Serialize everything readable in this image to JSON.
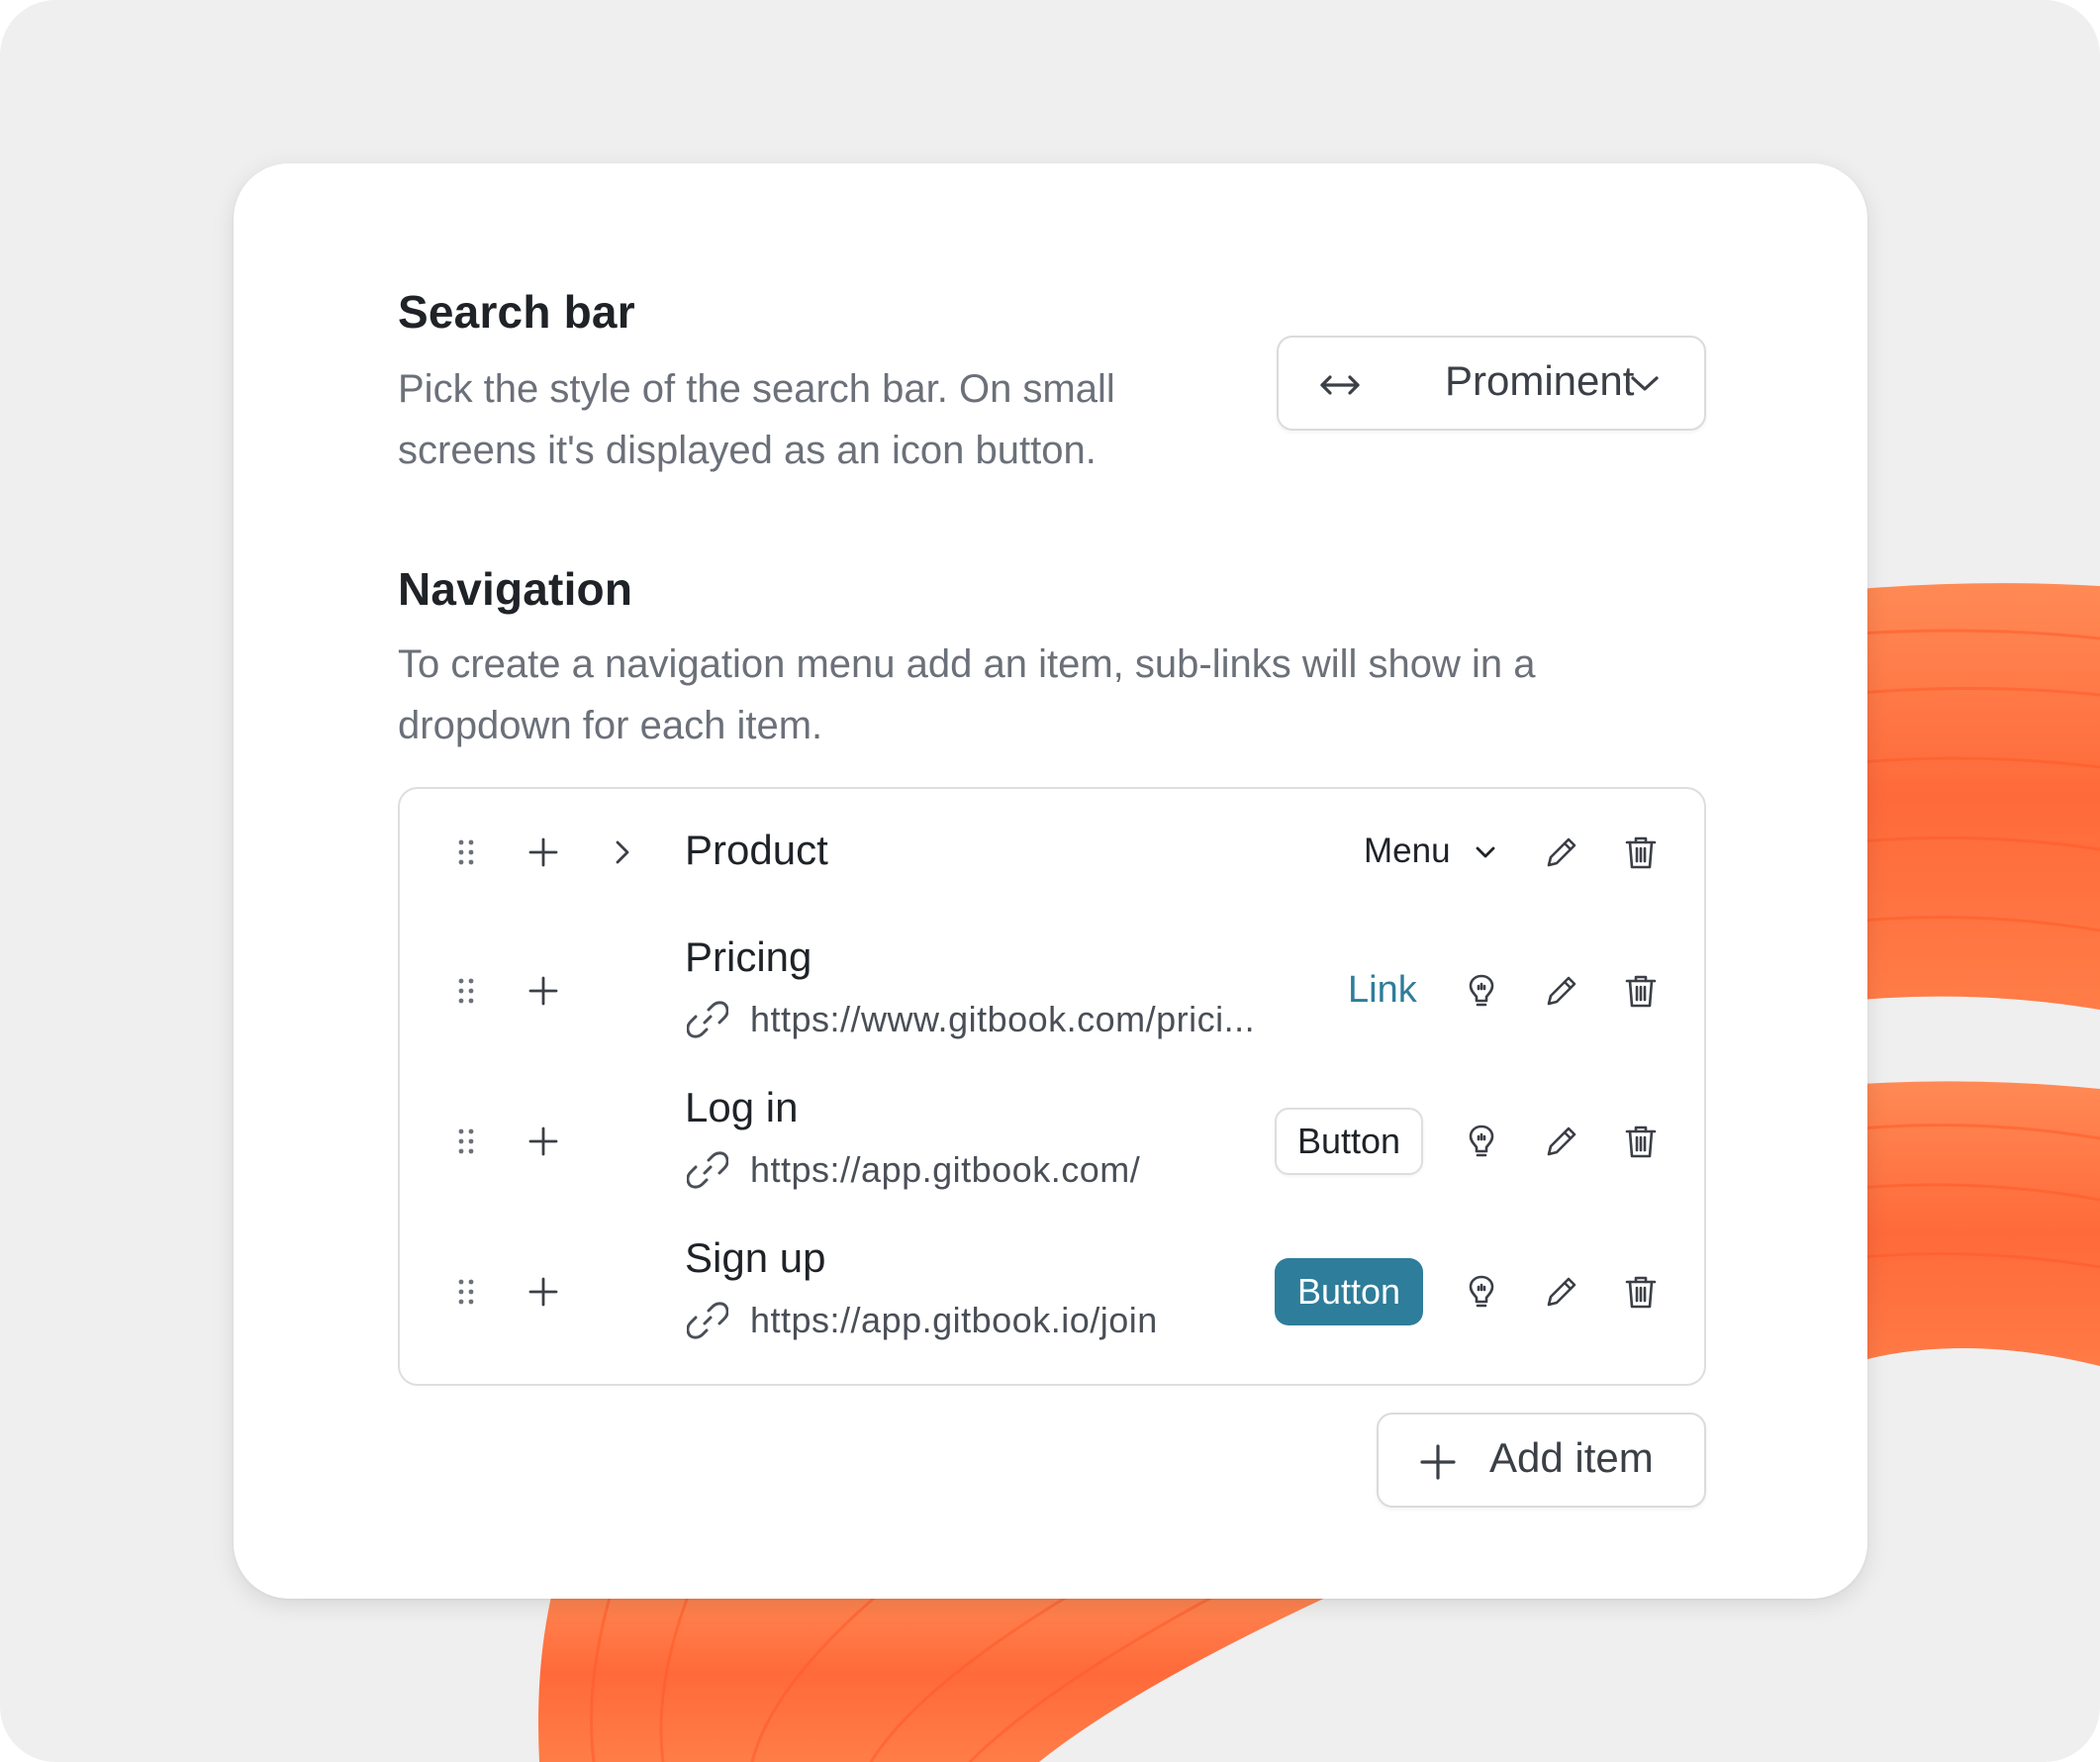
{
  "search_bar": {
    "title": "Search bar",
    "description_line1": "Pick the style of the search bar. On small",
    "description_line2": "screens it's displayed as an icon button.",
    "select_value": "Prominent"
  },
  "navigation": {
    "title": "Navigation",
    "description_line1": "To create a navigation menu add an item, sub-links will show in a",
    "description_line2": "dropdown for each item.",
    "items": [
      {
        "label": "Product",
        "type": "Menu"
      },
      {
        "label": "Pricing",
        "url": "https://www.gitbook.com/prici...",
        "type": "Link"
      },
      {
        "label": "Log in",
        "url": "https://app.gitbook.com/",
        "type": "Button"
      },
      {
        "label": "Sign up",
        "url": "https://app.gitbook.io/join",
        "type": "Button"
      }
    ],
    "add_item_label": "Add item"
  },
  "colors": {
    "accent": "#2e7d9a",
    "decoration": "#ff7a45"
  }
}
